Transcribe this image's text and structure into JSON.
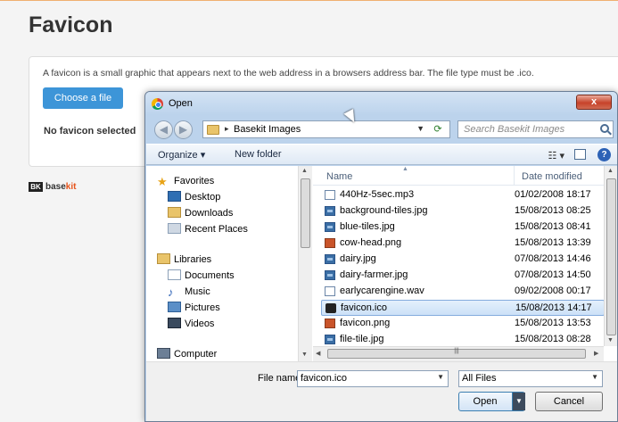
{
  "page": {
    "title": "Favicon",
    "description": "A favicon is a small graphic that appears next to the web address in a browsers address bar. The file type must be .ico.",
    "choose_file_label": "Choose a file",
    "status": "No favicon selected",
    "logo_mark": "BK",
    "logo_text_dark": "base",
    "logo_text_accent": "kit",
    "accent_color": "#3d95d8",
    "logo_accent_color": "#e6531a"
  },
  "dialog": {
    "title": "Open",
    "close_glyph": "x",
    "address": {
      "arrow": "▸",
      "folder": "Basekit Images"
    },
    "search_placeholder": "Search Basekit Images",
    "toolbar": {
      "organize": "Organize ▾",
      "new_folder": "New folder",
      "views_glyph": "☷ ▾",
      "help": "?"
    },
    "nav": {
      "favorites_header": "Favorites",
      "favorites": [
        "Desktop",
        "Downloads",
        "Recent Places"
      ],
      "libraries_header": "Libraries",
      "libraries": [
        "Documents",
        "Music",
        "Pictures",
        "Videos"
      ],
      "computer": "Computer"
    },
    "columns": {
      "name": "Name",
      "date": "Date modified"
    },
    "files": [
      {
        "name": "440Hz-5sec.mp3",
        "date": "01/02/2008 18:17",
        "icon": "audio-icon"
      },
      {
        "name": "background-tiles.jpg",
        "date": "15/08/2013 08:25",
        "icon": "image-icon"
      },
      {
        "name": "blue-tiles.jpg",
        "date": "15/08/2013 08:41",
        "icon": "image-icon"
      },
      {
        "name": "cow-head.png",
        "date": "15/08/2013 13:39",
        "icon": "png-icon"
      },
      {
        "name": "dairy.jpg",
        "date": "07/08/2013 14:46",
        "icon": "image-icon"
      },
      {
        "name": "dairy-farmer.jpg",
        "date": "07/08/2013 14:50",
        "icon": "image-icon"
      },
      {
        "name": "earlycarengine.wav",
        "date": "09/02/2008 00:17",
        "icon": "audio-icon"
      },
      {
        "name": "favicon.ico",
        "date": "15/08/2013 14:17",
        "icon": "favicon-icon",
        "selected": true
      },
      {
        "name": "favicon.png",
        "date": "15/08/2013 13:53",
        "icon": "png-icon"
      },
      {
        "name": "file-tile.jpg",
        "date": "15/08/2013 08:28",
        "icon": "image-icon"
      }
    ],
    "footer": {
      "file_name_label": "File name:",
      "file_name_value": "favicon.ico",
      "file_type": "All Files",
      "open_label": "Open",
      "cancel_label": "Cancel"
    }
  }
}
